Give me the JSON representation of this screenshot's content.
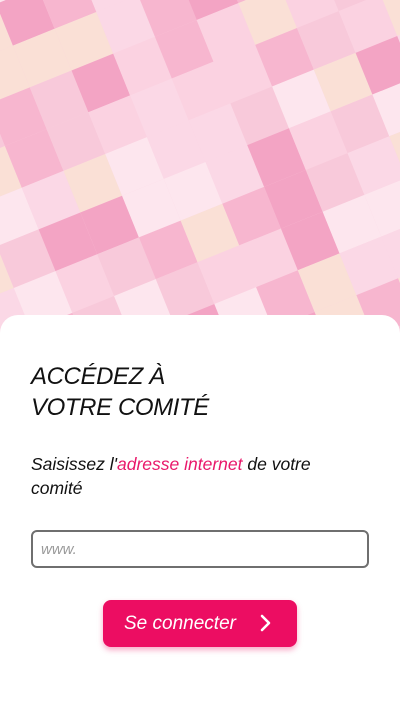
{
  "hero": {
    "background_colors": [
      "#fbd2e1",
      "#f7b6cf",
      "#f8c9da",
      "#fde6ee",
      "#fae0d6",
      "#f3a4c4",
      "#fbd8e6"
    ]
  },
  "login": {
    "title_line1": "ACCÉDEZ À",
    "title_line2": "VOTRE COMITÉ",
    "subtitle_before": "Saisissez l'",
    "subtitle_link": "adresse internet",
    "subtitle_after": " de votre comité",
    "url_placeholder": "www.",
    "url_value": "",
    "connect_label": "Se connecter",
    "connect_icon": "chevron-right-icon"
  },
  "colors": {
    "accent": "#ec0d62",
    "text": "#111111"
  }
}
